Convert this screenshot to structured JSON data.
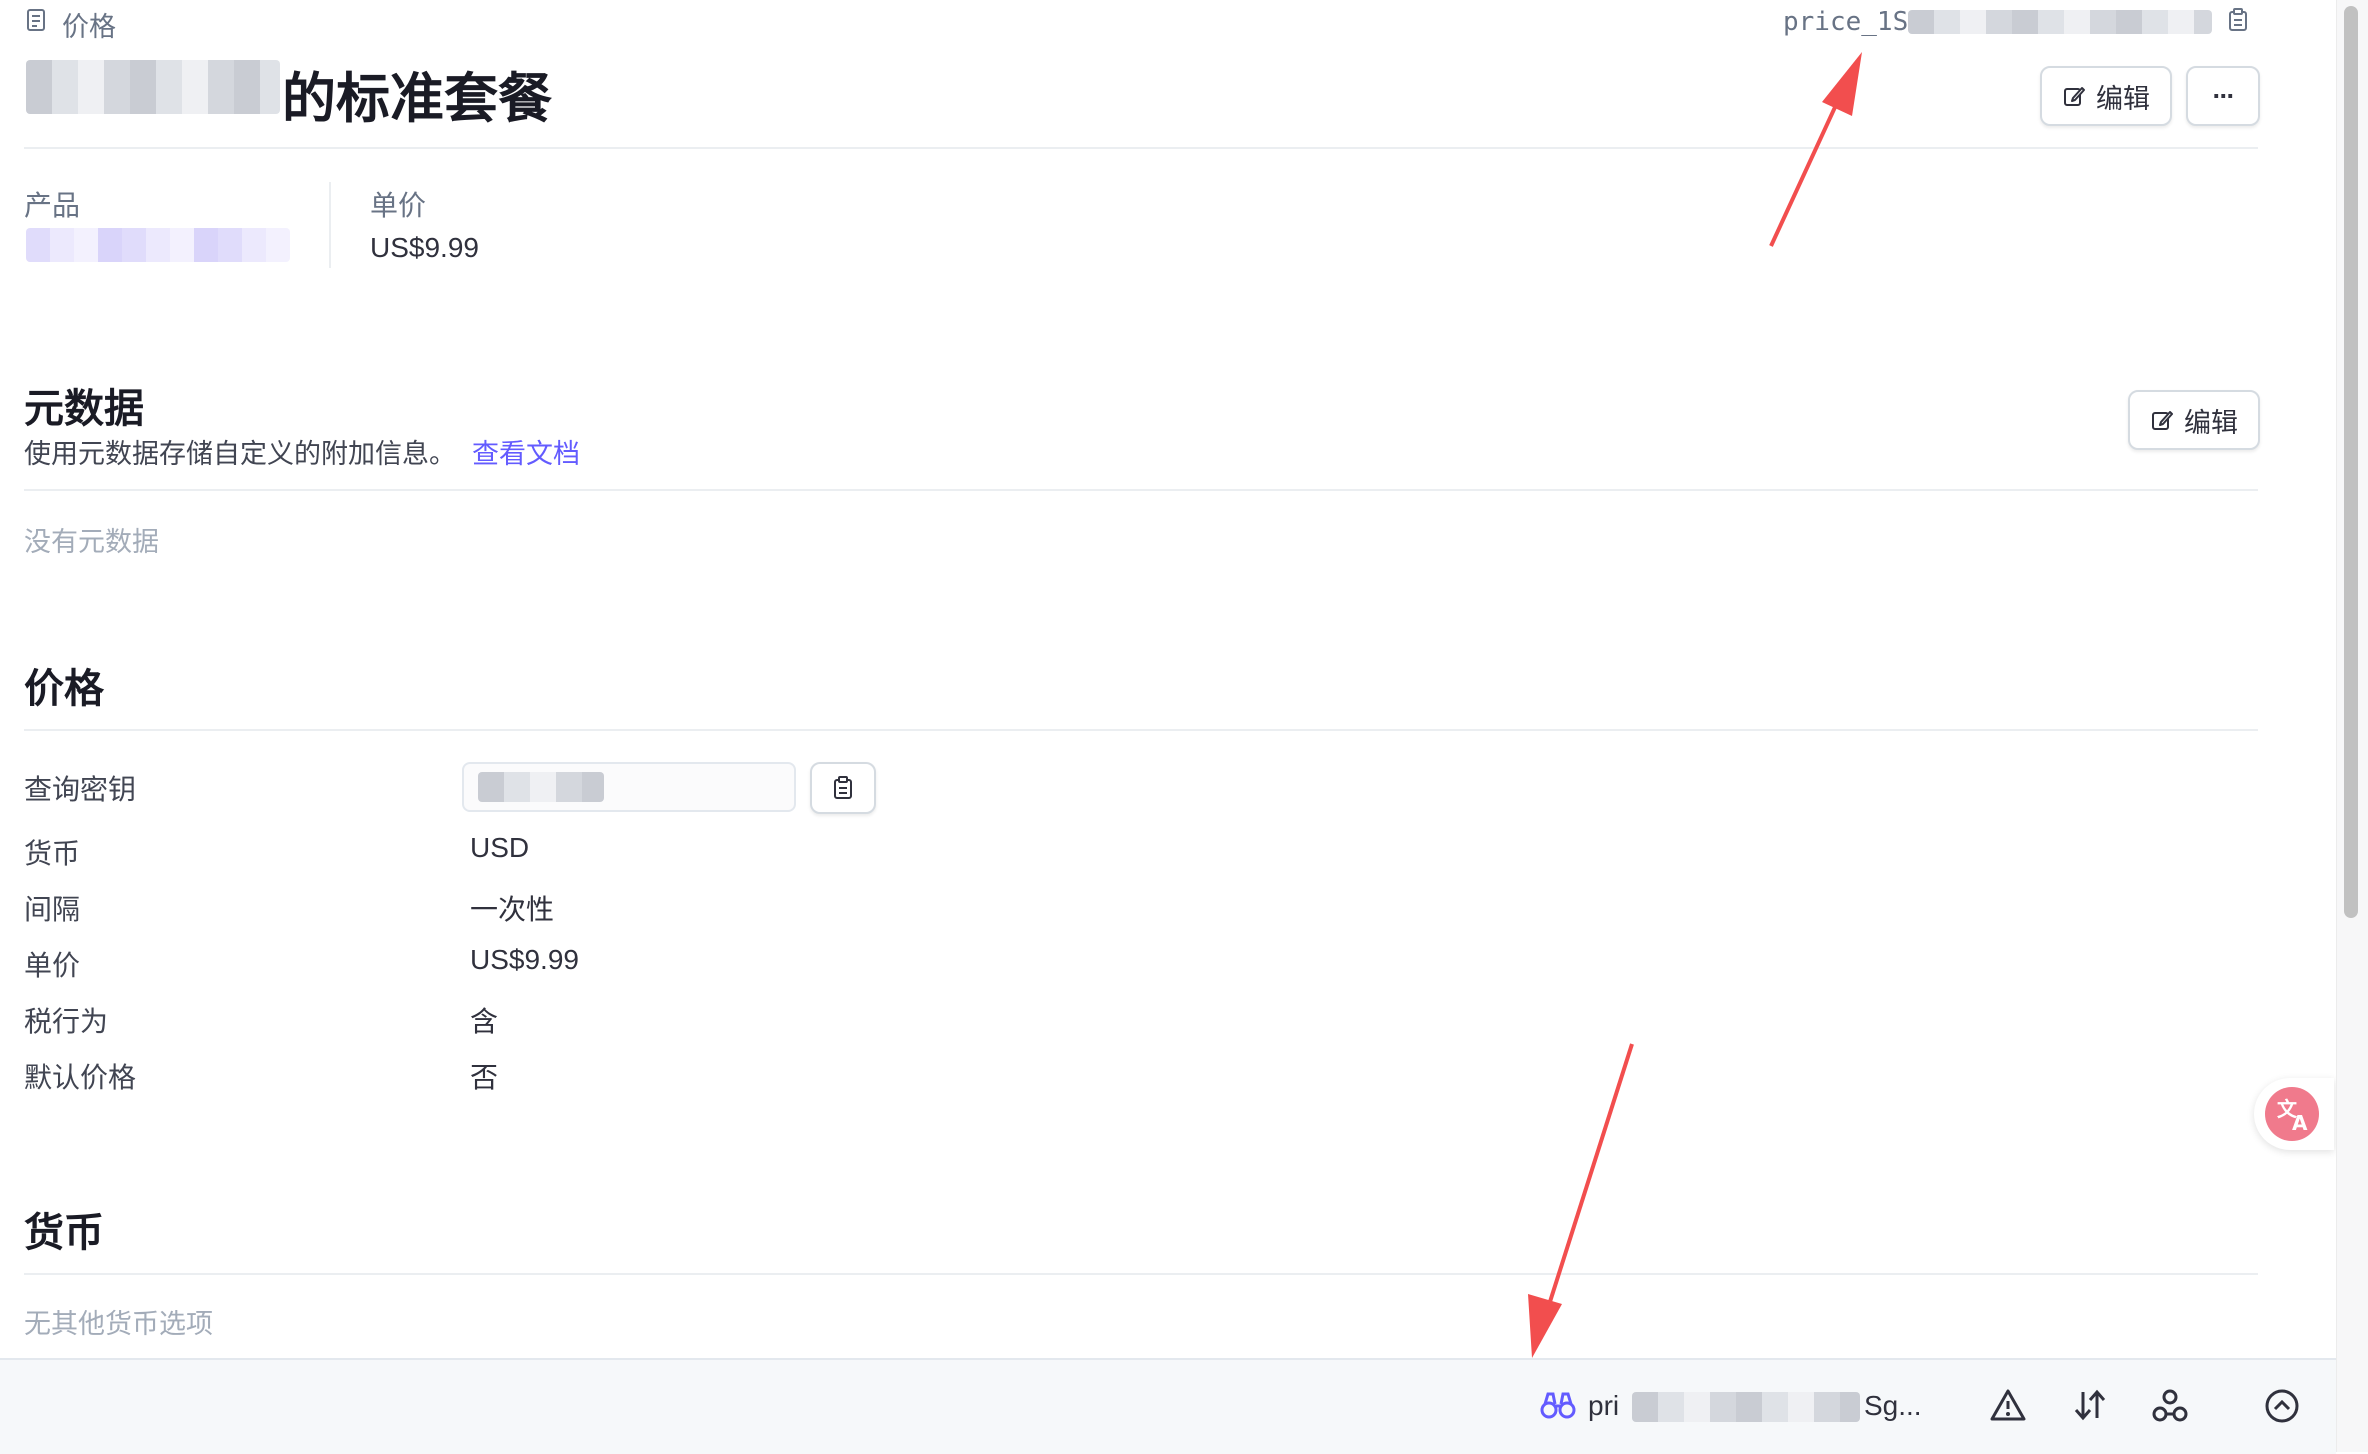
{
  "header": {
    "breadcrumb_label": "价格",
    "price_id": "price_1S",
    "title_suffix": "的标准套餐",
    "edit_label": "编辑",
    "more_label": "···"
  },
  "summary": {
    "product_label": "产品",
    "unit_price_label": "单价",
    "unit_price_value": "US$9.99"
  },
  "metadata": {
    "title": "元数据",
    "description": "使用元数据存储自定义的附加信息。",
    "docs_link": "查看文档",
    "edit_label": "编辑",
    "empty_text": "没有元数据"
  },
  "pricing": {
    "title": "价格",
    "rows": [
      {
        "label": "查询密钥",
        "value": ""
      },
      {
        "label": "货币",
        "value": "USD"
      },
      {
        "label": "间隔",
        "value": "一次性"
      },
      {
        "label": "单价",
        "value": "US$9.99"
      },
      {
        "label": "税行为",
        "value": "含"
      },
      {
        "label": "默认价格",
        "value": "否"
      }
    ]
  },
  "currency": {
    "title": "货币",
    "empty_text": "无其他货币选项"
  },
  "bottom_bar": {
    "inspector_prefix": "pri",
    "inspector_suffix": "Sg..."
  },
  "colors": {
    "accent": "#635bff",
    "arrow": "#f24e4e",
    "text": "#1a1b25",
    "muted": "#687385"
  }
}
